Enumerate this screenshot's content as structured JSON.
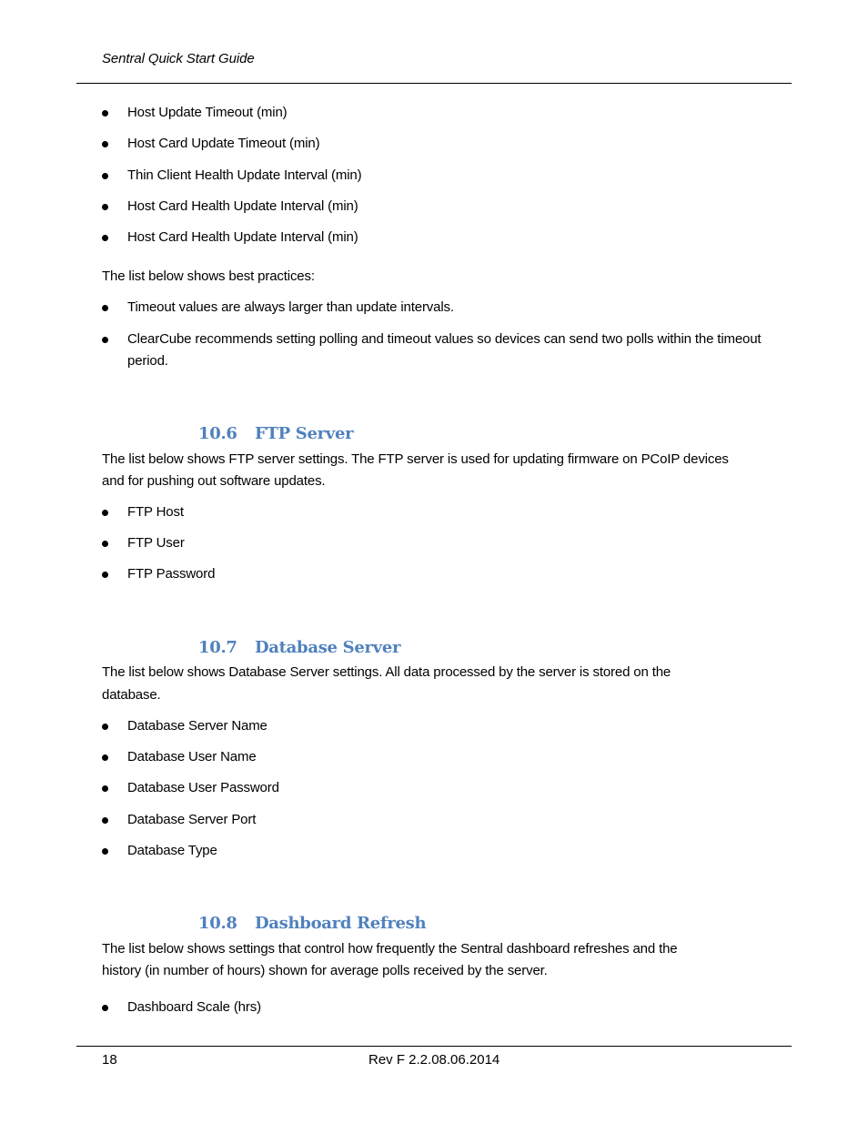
{
  "header": {
    "title": "Sentral Quick Start Guide"
  },
  "intro_list": [
    "Host Update Timeout (min)",
    "Host Card Update Timeout (min)",
    "Thin Client Health Update Interval (min)",
    "Host Card Health Update Interval (min)",
    "Host Card Health Update Interval (min)"
  ],
  "best_practices": {
    "lead": "The list below shows best practices:",
    "items": [
      "Timeout values are always larger than update intervals.",
      "ClearCube recommends setting polling and timeout values so devices can send two polls within the timeout period."
    ]
  },
  "sections": {
    "ftp": {
      "number": "10.6",
      "title": "FTP Server",
      "body_line1": "The list below shows FTP server settings. The FTP server is used for updating firmware on PCoIP devices",
      "body_line2": "and for pushing out software updates.",
      "items": [
        "FTP Host",
        "FTP User",
        "FTP Password"
      ]
    },
    "database": {
      "number": "10.7",
      "title": "Database Server",
      "body_line1": "The list below shows Database Server settings. All data processed by the server is stored on the",
      "body_line2": "database.",
      "items": [
        "Database Server Name",
        "Database User Name",
        "Database User Password",
        "Database Server Port",
        "Database Type"
      ]
    },
    "dashboard": {
      "number": "10.8",
      "title": "Dashboard Refresh",
      "body_line1": "The list below shows settings that control how frequently the Sentral dashboard refreshes and the",
      "body_line2": "history (in number of hours) shown for average polls received by the server.",
      "items": [
        "Dashboard Scale (hrs)"
      ]
    }
  },
  "footer": {
    "page_number": "18",
    "revision": "Rev F 2.2.08.06.2014"
  },
  "colors": {
    "heading": "#4F81BD",
    "text": "#000000"
  }
}
